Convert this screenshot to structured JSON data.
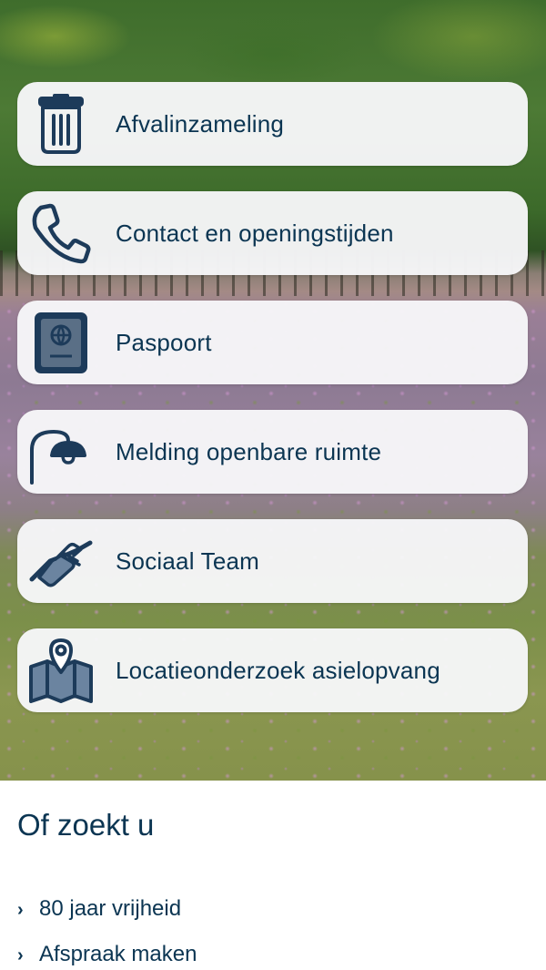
{
  "tiles": [
    {
      "label": "Afvalinzameling",
      "icon": "trash-bin-icon"
    },
    {
      "label": "Contact en openingstijden",
      "icon": "phone-icon"
    },
    {
      "label": "Paspoort",
      "icon": "passport-icon"
    },
    {
      "label": "Melding openbare ruimte",
      "icon": "street-lamp-icon"
    },
    {
      "label": "Sociaal Team",
      "icon": "handshake-icon"
    },
    {
      "label": "Locatieonderzoek asielopvang",
      "icon": "map-pin-icon"
    }
  ],
  "section": {
    "title": "Of zoekt u",
    "links": [
      {
        "label": "80 jaar vrijheid"
      },
      {
        "label": "Afspraak maken"
      }
    ]
  },
  "colors": {
    "text": "#0b3552",
    "icon": "#1d3b5a",
    "tile_bg": "#f7f7f9"
  }
}
